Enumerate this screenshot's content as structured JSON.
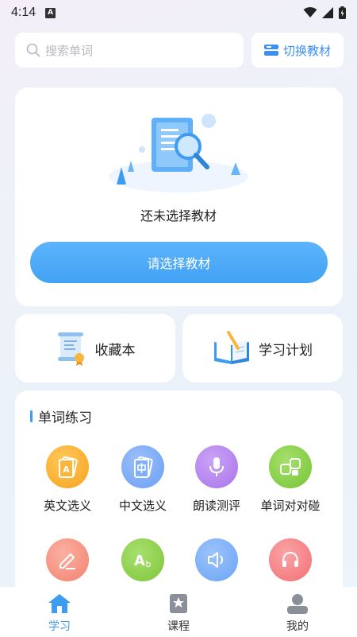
{
  "status_bar": {
    "time": "4:14",
    "notification_icon": "A"
  },
  "search": {
    "placeholder": "搜索单词"
  },
  "switch_button": {
    "label": "切换教材"
  },
  "empty_state": {
    "message": "还未选择教材",
    "button_label": "请选择教材"
  },
  "quick_links": [
    {
      "label": "收藏本",
      "icon": "scroll-certificate-icon"
    },
    {
      "label": "学习计划",
      "icon": "open-book-icon"
    }
  ],
  "practice": {
    "title": "单词练习",
    "items": [
      {
        "label": "英文选义",
        "icon": "english-card-icon",
        "color": "#fbab2f"
      },
      {
        "label": "中文选义",
        "icon": "chinese-card-icon",
        "color": "#79a8f6"
      },
      {
        "label": "朗读测评",
        "icon": "microphone-icon",
        "color": "#b886f0"
      },
      {
        "label": "单词对对碰",
        "icon": "match-blocks-icon",
        "color": "#84d042"
      },
      {
        "label": "",
        "icon": "pencil-icon",
        "color": "#f58e7d"
      },
      {
        "label": "",
        "icon": "spelling-ab-icon",
        "color": "#8fd045"
      },
      {
        "label": "",
        "icon": "speaker-icon",
        "color": "#72a9f7"
      },
      {
        "label": "",
        "icon": "headphones-icon",
        "color": "#f5787b"
      }
    ]
  },
  "tabbar": [
    {
      "label": "学习",
      "icon": "home-icon",
      "active": true
    },
    {
      "label": "课程",
      "icon": "bookmark-icon",
      "active": false
    },
    {
      "label": "我的",
      "icon": "profile-icon",
      "active": false
    }
  ]
}
